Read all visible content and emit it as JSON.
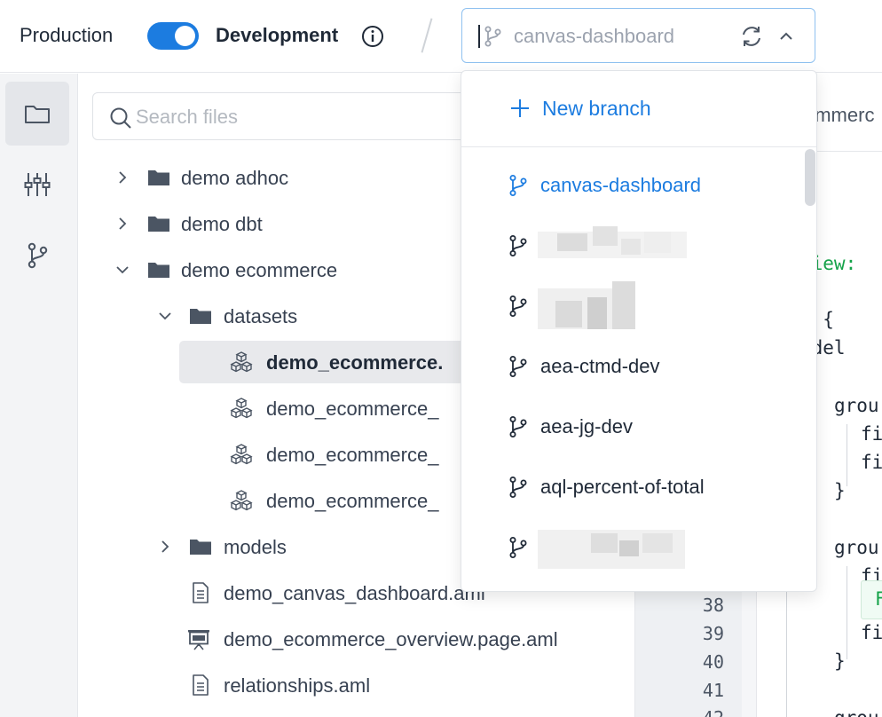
{
  "topbar": {
    "production_label": "Production",
    "development_label": "Development",
    "mode_toggle_on": true,
    "branch_selected": "canvas-dashboard"
  },
  "colors": {
    "accent": "#1c7ce0",
    "text": "#1f2937",
    "muted": "#9ca3af"
  },
  "rail": {
    "items": [
      {
        "icon": "folder-icon",
        "active": true
      },
      {
        "icon": "sliders-icon",
        "active": false
      },
      {
        "icon": "git-branch-icon",
        "active": false
      }
    ]
  },
  "filetree": {
    "search_placeholder": "Search files",
    "rows": [
      {
        "label": "demo adhoc",
        "type": "folder",
        "expanded": false,
        "depth": 0
      },
      {
        "label": "demo dbt",
        "type": "folder",
        "expanded": false,
        "depth": 0
      },
      {
        "label": "demo ecommerce",
        "type": "folder",
        "expanded": true,
        "depth": 0
      },
      {
        "label": "datasets",
        "type": "folder",
        "expanded": true,
        "depth": 1
      },
      {
        "label": "demo_ecommerce.",
        "type": "dataset",
        "selected": true,
        "depth": 2
      },
      {
        "label": "demo_ecommerce_",
        "type": "dataset",
        "depth": 2
      },
      {
        "label": "demo_ecommerce_",
        "type": "dataset",
        "depth": 2
      },
      {
        "label": "demo_ecommerce_",
        "type": "dataset",
        "depth": 2
      },
      {
        "label": "models",
        "type": "folder",
        "expanded": false,
        "depth": 1
      },
      {
        "label": "demo_canvas_dashboard.aml",
        "type": "file",
        "depth": 1
      },
      {
        "label": "demo_ecommerce_overview.page.aml",
        "type": "page",
        "depth": 1
      },
      {
        "label": "relationships.aml",
        "type": "file",
        "depth": 1
      }
    ]
  },
  "editor": {
    "tab_label": "ommerc",
    "line_numbers": [
      "38",
      "39",
      "40",
      "41",
      "42"
    ],
    "code_fragments": [
      {
        "text": "view:",
        "green": true
      },
      {
        "text": "w {",
        "green": false
      },
      {
        "text": "odel",
        "green": false
      },
      {
        "text": "grou",
        "green": false
      },
      {
        "text": "fi",
        "green": false
      },
      {
        "text": "fi",
        "green": false
      },
      {
        "text": "}",
        "green": false
      },
      {
        "text": "grou",
        "green": false
      },
      {
        "text": "fi",
        "green": false
      },
      {
        "text": "F",
        "green": true
      },
      {
        "text": "fi",
        "green": false
      },
      {
        "text": "}",
        "green": false
      },
      {
        "text": "grou",
        "green": false
      }
    ]
  },
  "branch_dropdown": {
    "new_branch_label": "New branch",
    "branches": [
      {
        "label": "canvas-dashboard",
        "current": true,
        "redacted": false
      },
      {
        "label": "",
        "current": false,
        "redacted": true
      },
      {
        "label": "",
        "current": false,
        "redacted": true
      },
      {
        "label": "aea-ctmd-dev",
        "current": false,
        "redacted": false
      },
      {
        "label": "aea-jg-dev",
        "current": false,
        "redacted": false
      },
      {
        "label": "aql-percent-of-total",
        "current": false,
        "redacted": false
      },
      {
        "label": "",
        "current": false,
        "redacted": true
      }
    ]
  }
}
